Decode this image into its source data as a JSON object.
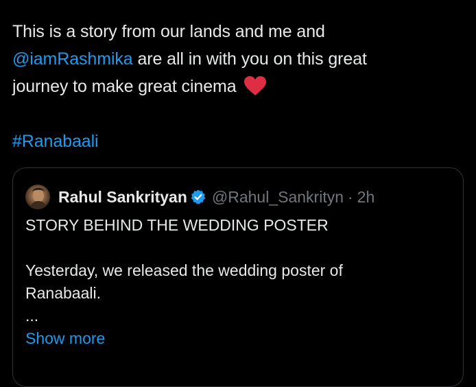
{
  "tweet": {
    "line1": "This is a story from our lands and me and",
    "mention": "@iamRashmika",
    "line2_rest": " are all in with you on this great",
    "line3": "journey to make great cinema ",
    "hashtag": "#Ranabaali"
  },
  "quote": {
    "display_name": "Rahul Sankrityan",
    "handle": "@Rahul_Sankrityn",
    "separator": "·",
    "time": "2h",
    "title": "STORY BEHIND THE WEDDING POSTER",
    "para_line1": "Yesterday, we released the wedding poster of",
    "para_line2": "Ranabaali.",
    "ellipsis": "...",
    "show_more": "Show more"
  },
  "colors": {
    "background": "#000000",
    "text": "#e7e9ea",
    "link": "#1d9bf0",
    "muted": "#71767b",
    "border": "#2f3336",
    "heart": "#f91880",
    "verified": "#1d9bf0"
  },
  "icons": {
    "heart": "red-heart-emoji",
    "verified": "verified-badge-icon"
  }
}
